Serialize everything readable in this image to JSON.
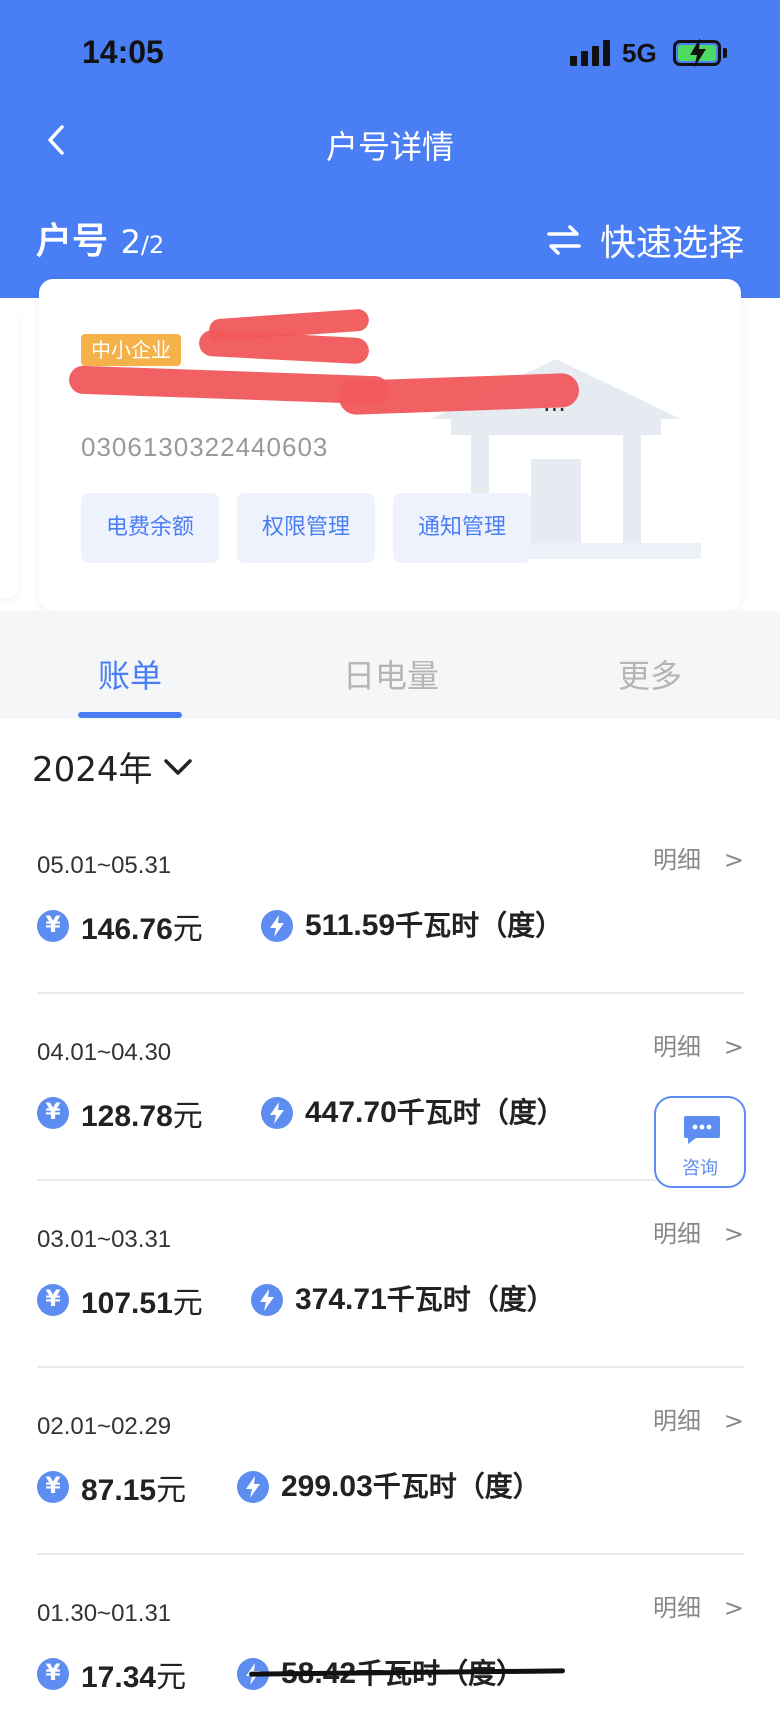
{
  "status": {
    "time": "14:05",
    "network": "5G"
  },
  "nav": {
    "title": "户号详情"
  },
  "account": {
    "label": "户号",
    "index": "2",
    "total": "/2",
    "quick_select": "快速选择",
    "badge": "中小企业",
    "name_tail": "...",
    "number": "0306130322440603",
    "actions": [
      "电费余额",
      "权限管理",
      "通知管理"
    ]
  },
  "tabs": [
    "账单",
    "日电量",
    "更多"
  ],
  "year": "2024年",
  "detail_label": "明细",
  "detail_arrow": ">",
  "bills": [
    {
      "period": "05.01~05.31",
      "amount": "146.76",
      "amount_unit": "元",
      "energy": "511.59",
      "energy_unit": "千瓦时（度）"
    },
    {
      "period": "04.01~04.30",
      "amount": "128.78",
      "amount_unit": "元",
      "energy": "447.70",
      "energy_unit": "千瓦时（度）"
    },
    {
      "period": "03.01~03.31",
      "amount": "107.51",
      "amount_unit": "元",
      "energy": "374.71",
      "energy_unit": "千瓦时（度）"
    },
    {
      "period": "02.01~02.29",
      "amount": "87.15",
      "amount_unit": "元",
      "energy": "299.03",
      "energy_unit": "千瓦时（度）"
    },
    {
      "period": "01.30~01.31",
      "amount": "17.34",
      "amount_unit": "元",
      "energy": "58.42",
      "energy_unit": "千瓦时（度）"
    }
  ],
  "consult": {
    "label": "咨询"
  },
  "colors": {
    "primary": "#4a7ef5",
    "badge": "#f6b24a",
    "redaction": "#f0595c"
  },
  "icons": {
    "yen": "¥",
    "bolt": "⚡"
  }
}
